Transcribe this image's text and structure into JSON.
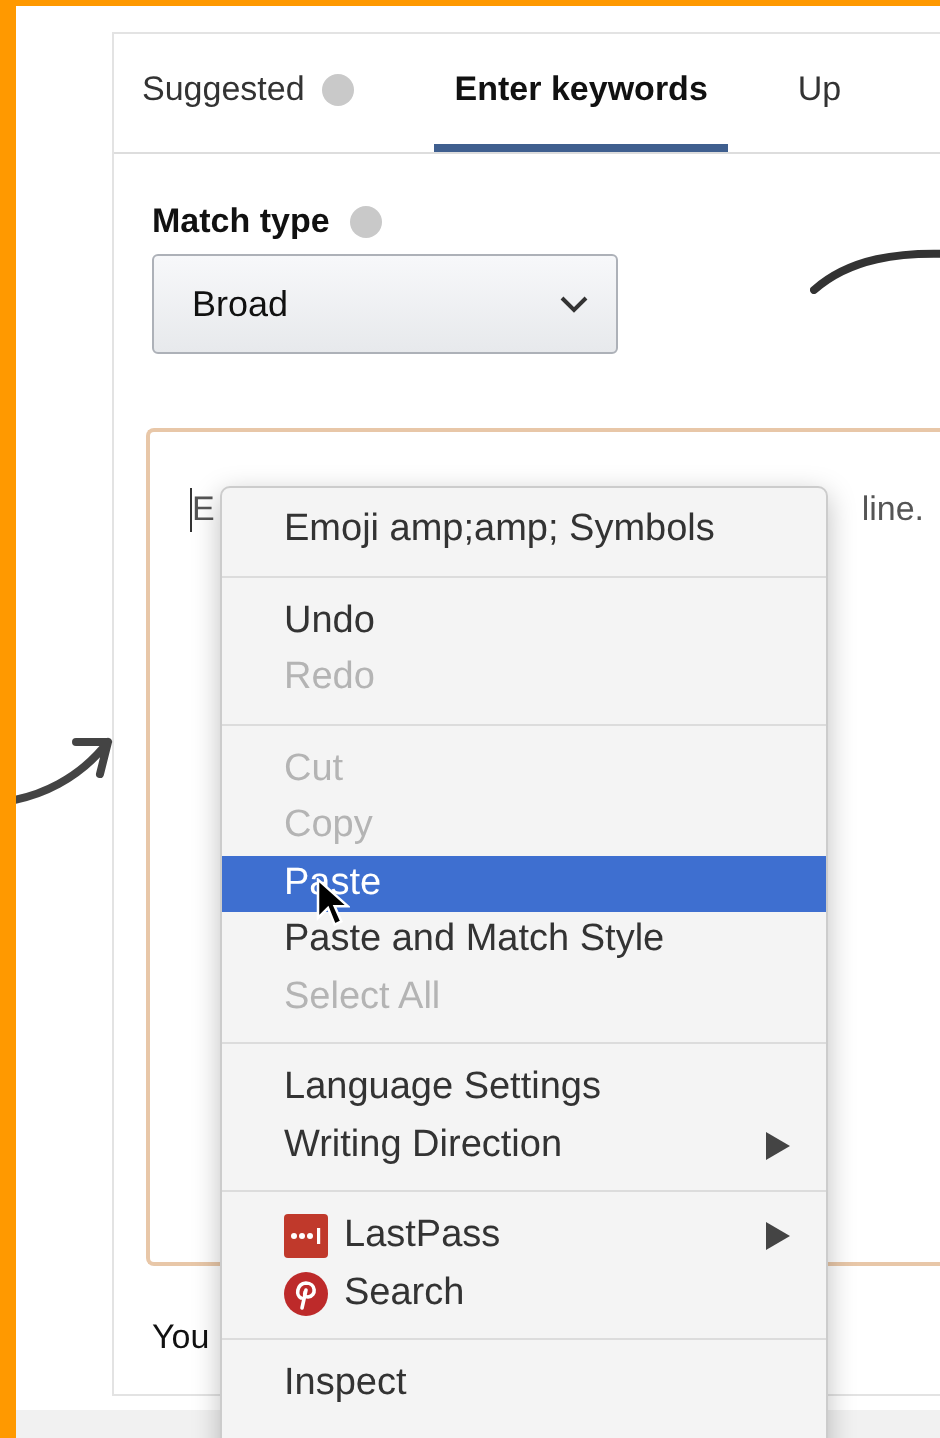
{
  "tabs": [
    {
      "label": "Suggested",
      "info": true,
      "selected": false
    },
    {
      "label": "Enter keywords",
      "info": false,
      "selected": true
    },
    {
      "label": "Up",
      "info": false,
      "selected": false
    }
  ],
  "match_type": {
    "label": "Match type",
    "value": "Broad"
  },
  "keywords_field": {
    "placeholder_start": "E",
    "placeholder_end": "line."
  },
  "footer_text": "You",
  "context_menu": {
    "sections": [
      {
        "items": [
          {
            "label": "Emoji amp;amp; Symbols",
            "disabled": false,
            "selected": false,
            "submenu": false
          }
        ]
      },
      {
        "items": [
          {
            "label": "Undo",
            "disabled": false,
            "selected": false,
            "submenu": false
          },
          {
            "label": "Redo",
            "disabled": true,
            "selected": false,
            "submenu": false
          }
        ]
      },
      {
        "items": [
          {
            "label": "Cut",
            "disabled": true,
            "selected": false,
            "submenu": false
          },
          {
            "label": "Copy",
            "disabled": true,
            "selected": false,
            "submenu": false
          },
          {
            "label": "Paste",
            "disabled": false,
            "selected": true,
            "submenu": false
          },
          {
            "label": "Paste and Match Style",
            "disabled": false,
            "selected": false,
            "submenu": false
          },
          {
            "label": "Select All",
            "disabled": true,
            "selected": false,
            "submenu": false
          }
        ]
      },
      {
        "items": [
          {
            "label": "Language Settings",
            "disabled": false,
            "selected": false,
            "submenu": false
          },
          {
            "label": "Writing Direction",
            "disabled": false,
            "selected": false,
            "submenu": true
          }
        ]
      },
      {
        "items": [
          {
            "label": "LastPass",
            "kind": "password",
            "disabled": false,
            "selected": false,
            "submenu": true
          },
          {
            "label": "Search",
            "kind": "pin",
            "disabled": false,
            "selected": false,
            "submenu": false
          }
        ]
      },
      {
        "items": [
          {
            "label": "Inspect",
            "disabled": false,
            "selected": false,
            "submenu": false
          }
        ]
      }
    ]
  }
}
